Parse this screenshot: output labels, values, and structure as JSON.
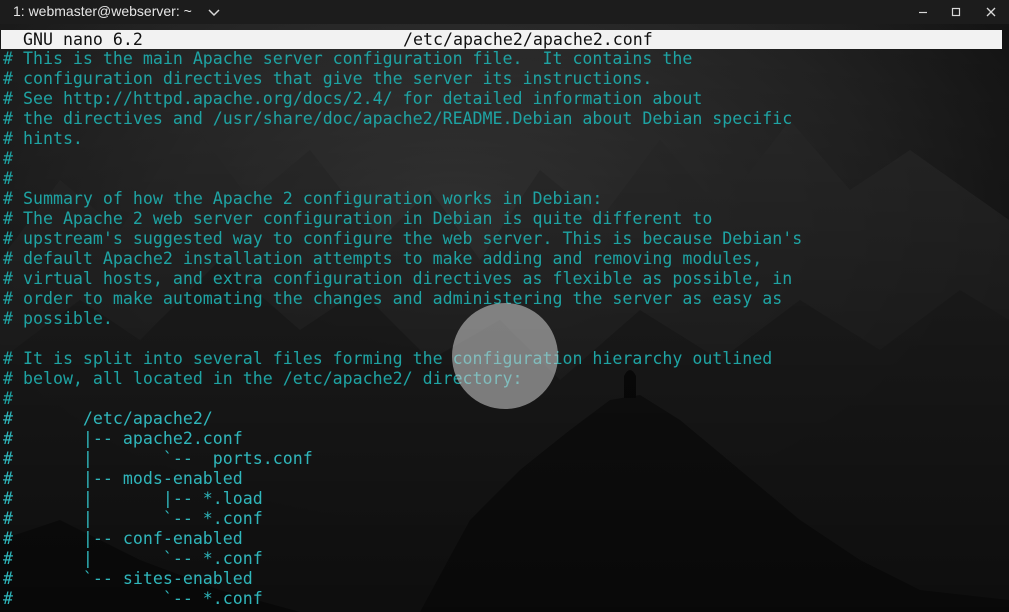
{
  "window": {
    "title": "1: webmaster@webserver: ~",
    "dropdown_icon": "chevron-down-icon",
    "controls": [
      "minimize-icon",
      "maximize-icon",
      "close-icon"
    ]
  },
  "nano": {
    "version_label": "GNU nano 6.2",
    "filename": "/etc/apache2/apache2.conf"
  },
  "colors": {
    "comment_text": "#1ea3a3",
    "header_bg": "#f2f2f2",
    "titlebar_bg": "#1c1c1c"
  },
  "lines": [
    "# This is the main Apache server configuration file.  It contains the",
    "# configuration directives that give the server its instructions.",
    "# See http://httpd.apache.org/docs/2.4/ for detailed information about",
    "# the directives and /usr/share/doc/apache2/README.Debian about Debian specific",
    "# hints.",
    "#",
    "#",
    "# Summary of how the Apache 2 configuration works in Debian:",
    "# The Apache 2 web server configuration in Debian is quite different to",
    "# upstream's suggested way to configure the web server. This is because Debian's",
    "# default Apache2 installation attempts to make adding and removing modules,",
    "# virtual hosts, and extra configuration directives as flexible as possible, in",
    "# order to make automating the changes and administering the server as easy as",
    "# possible.",
    "",
    "# It is split into several files forming the configuration hierarchy outlined",
    "# below, all located in the /etc/apache2/ directory:",
    "#",
    "#       /etc/apache2/",
    "#       |-- apache2.conf",
    "#       |       `--  ports.conf",
    "#       |-- mods-enabled",
    "#       |       |-- *.load",
    "#       |       `-- *.conf",
    "#       |-- conf-enabled",
    "#       |       `-- *.conf",
    "#       `-- sites-enabled",
    "#               `-- *.conf"
  ]
}
